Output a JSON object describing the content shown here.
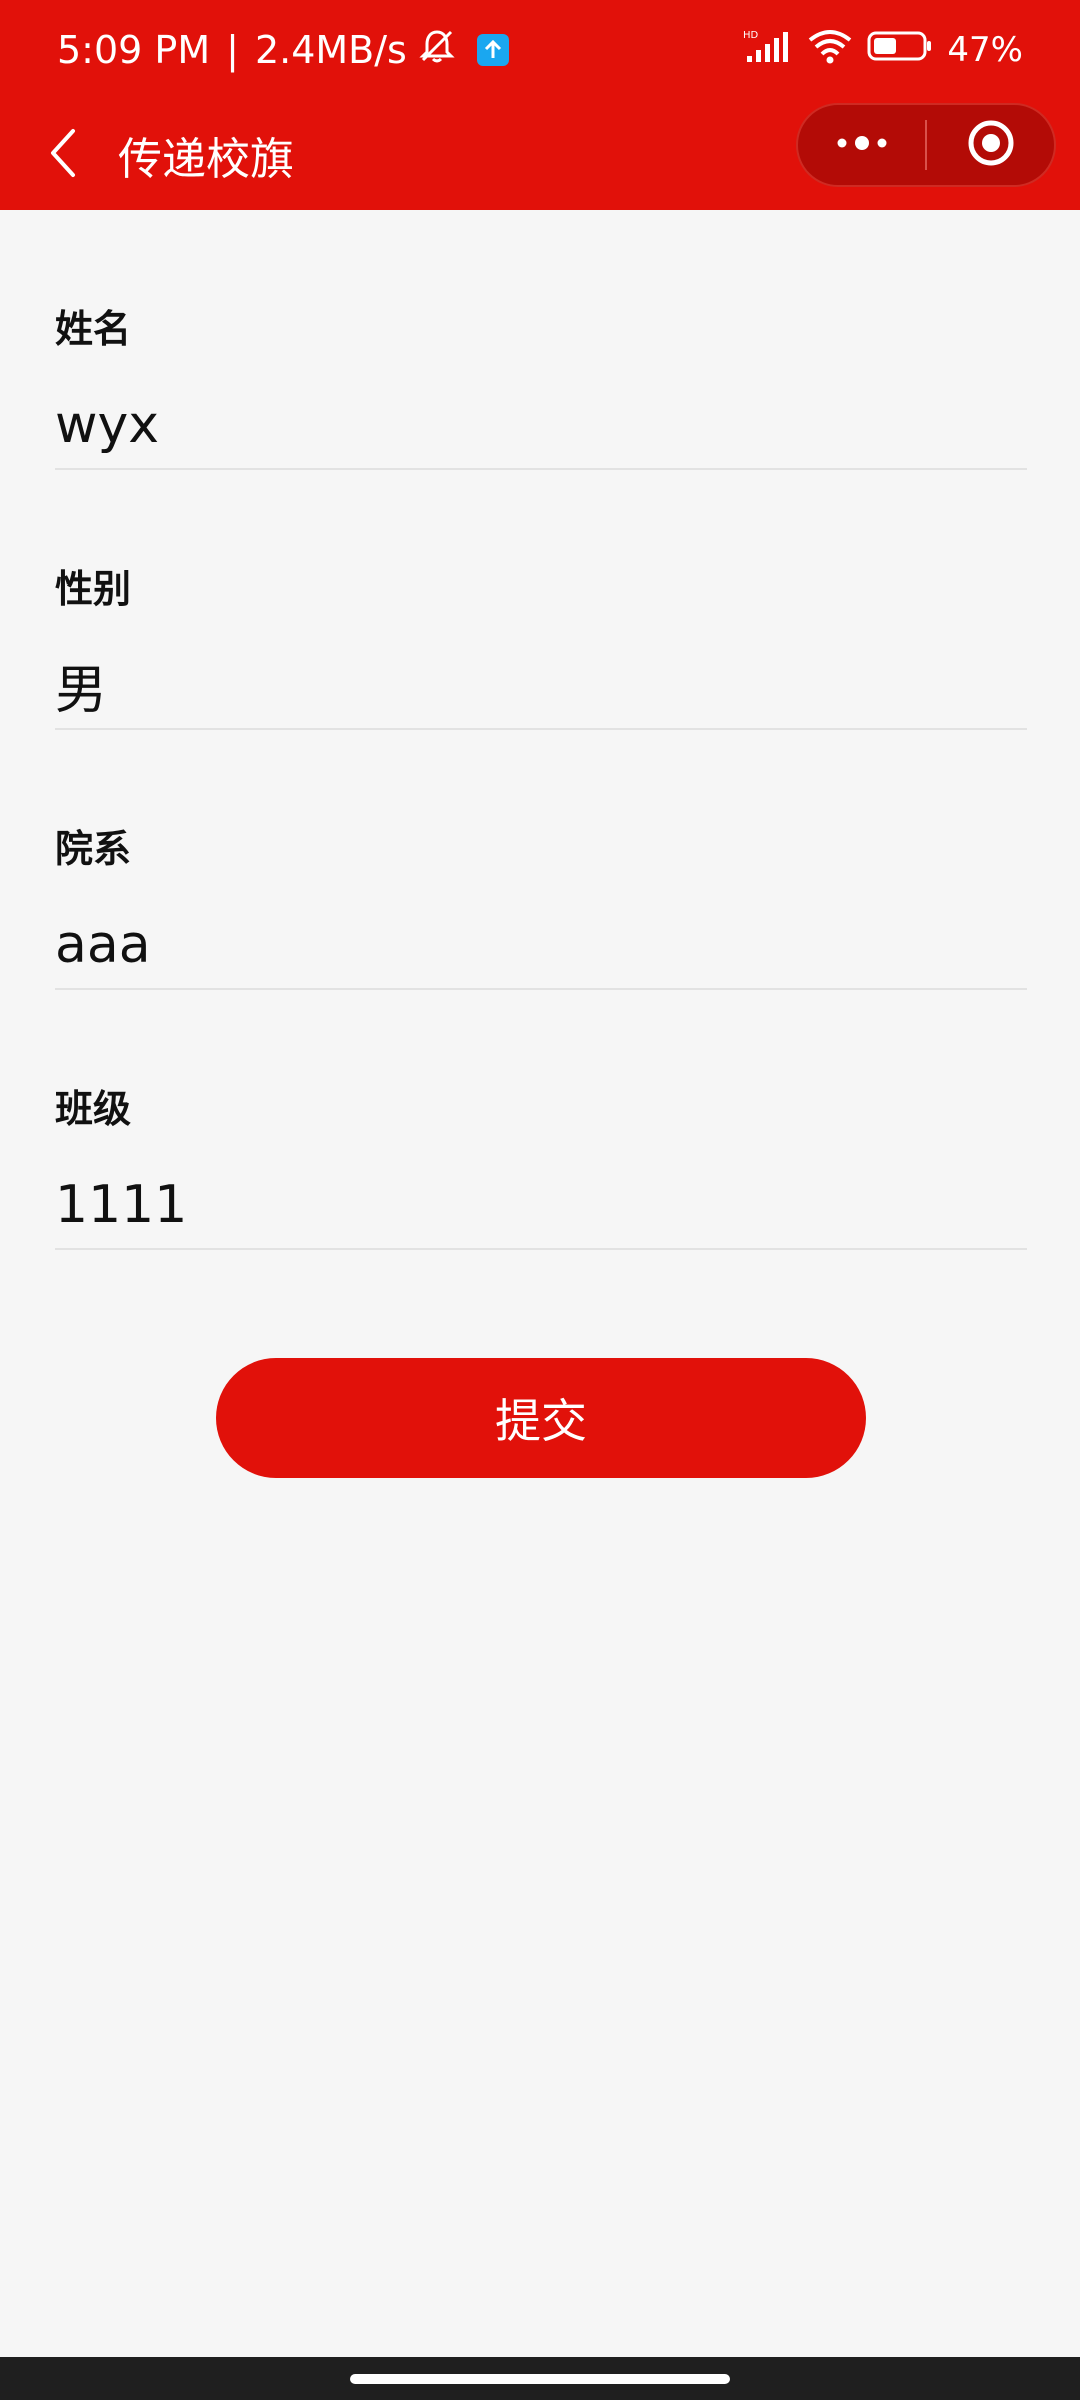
{
  "status_bar": {
    "time": "5:09 PM",
    "speed": "2.4MB/s",
    "battery": "47%"
  },
  "nav": {
    "title": "传递校旗"
  },
  "form": {
    "fields": [
      {
        "label": "姓名",
        "value": "wyx"
      },
      {
        "label": "性别",
        "value": "男"
      },
      {
        "label": "院系",
        "value": "aaa"
      },
      {
        "label": "班级",
        "value": "1111"
      }
    ],
    "submit_label": "提交"
  },
  "colors": {
    "brand": "#e1110a",
    "capsule": "#b30b06",
    "background": "#f6f6f6"
  }
}
